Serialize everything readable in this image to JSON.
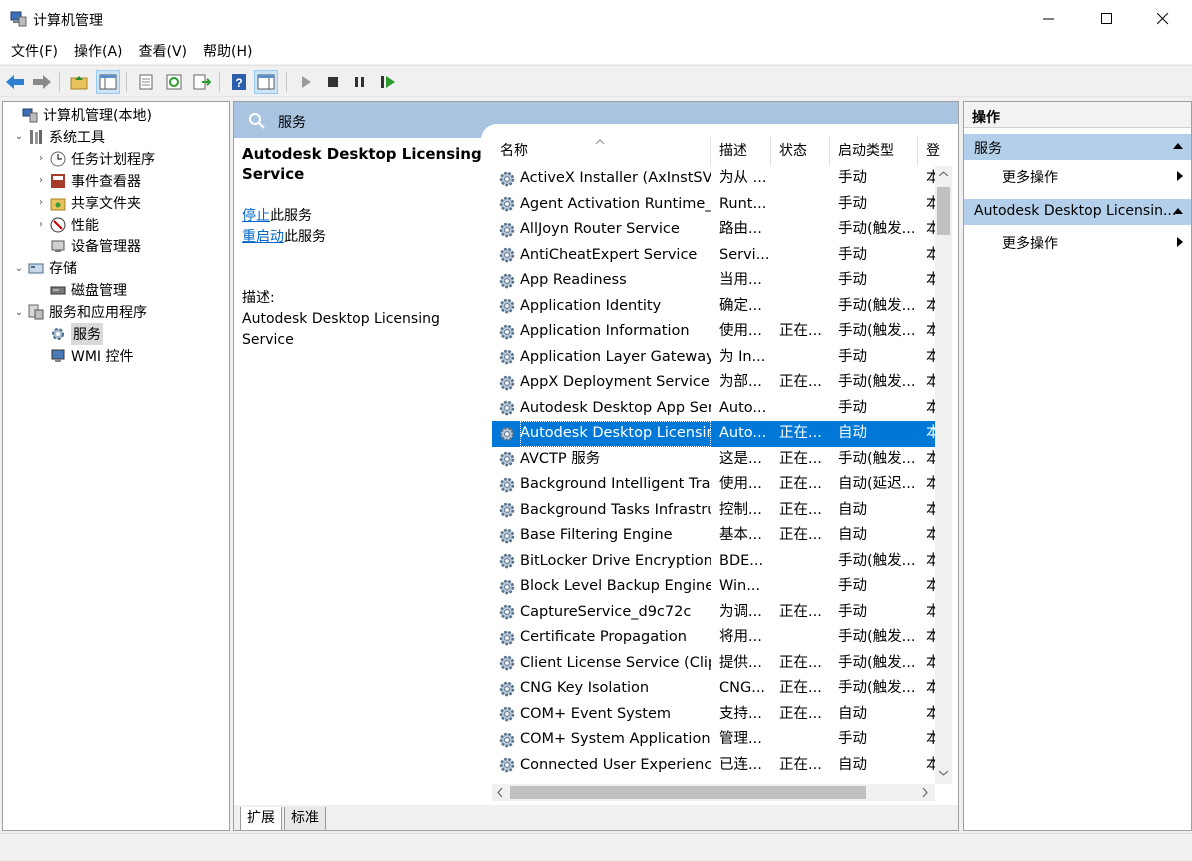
{
  "window": {
    "title": "计算机管理"
  },
  "menu": [
    "文件(F)",
    "操作(A)",
    "查看(V)",
    "帮助(H)"
  ],
  "tree": [
    {
      "label": "计算机管理(本地)",
      "indent": 0,
      "expander": "",
      "icon": "computer-management-icon"
    },
    {
      "label": "系统工具",
      "indent": 1,
      "expander": "v",
      "icon": "system-tools-icon"
    },
    {
      "label": "任务计划程序",
      "indent": 2,
      "expander": ">",
      "icon": "task-scheduler-icon"
    },
    {
      "label": "事件查看器",
      "indent": 2,
      "expander": ">",
      "icon": "event-viewer-icon"
    },
    {
      "label": "共享文件夹",
      "indent": 2,
      "expander": ">",
      "icon": "shared-folders-icon"
    },
    {
      "label": "性能",
      "indent": 2,
      "expander": ">",
      "icon": "performance-icon"
    },
    {
      "label": "设备管理器",
      "indent": 2,
      "expander": "",
      "icon": "device-manager-icon"
    },
    {
      "label": "存储",
      "indent": 1,
      "expander": "v",
      "icon": "storage-icon"
    },
    {
      "label": "磁盘管理",
      "indent": 2,
      "expander": "",
      "icon": "disk-management-icon"
    },
    {
      "label": "服务和应用程序",
      "indent": 1,
      "expander": "v",
      "icon": "services-apps-icon"
    },
    {
      "label": "服务",
      "indent": 2,
      "expander": "",
      "icon": "services-icon",
      "selected": true
    },
    {
      "label": "WMI 控件",
      "indent": 2,
      "expander": "",
      "icon": "wmi-control-icon"
    }
  ],
  "center": {
    "header_title": "服务",
    "detail": {
      "service_name": "Autodesk Desktop Licensing Service",
      "stop_link": "停止",
      "stop_suffix": "此服务",
      "restart_link": "重启动",
      "restart_suffix": "此服务",
      "desc_label": "描述:",
      "desc_text": "Autodesk Desktop Licensing Service"
    },
    "columns": [
      "名称",
      "描述",
      "状态",
      "启动类型",
      "登"
    ],
    "rows": [
      [
        "ActiveX Installer (AxInstSV)",
        "为从 ...",
        "",
        "手动",
        "本"
      ],
      [
        "Agent Activation Runtime_...",
        "Runt...",
        "",
        "手动",
        "本"
      ],
      [
        "AllJoyn Router Service",
        "路由...",
        "",
        "手动(触发...",
        "本"
      ],
      [
        "AntiCheatExpert Service",
        "Servi...",
        "",
        "手动",
        "本"
      ],
      [
        "App Readiness",
        "当用...",
        "",
        "手动",
        "本"
      ],
      [
        "Application Identity",
        "确定...",
        "",
        "手动(触发...",
        "本"
      ],
      [
        "Application Information",
        "使用...",
        "正在...",
        "手动(触发...",
        "本"
      ],
      [
        "Application Layer Gateway ...",
        "为 In...",
        "",
        "手动",
        "本"
      ],
      [
        "AppX Deployment Service ...",
        "为部...",
        "正在...",
        "手动(触发...",
        "本"
      ],
      [
        "Autodesk Desktop App Ser...",
        "Auto...",
        "",
        "手动",
        "本"
      ],
      [
        "Autodesk Desktop Licensin...",
        "Auto...",
        "正在...",
        "自动",
        "本"
      ],
      [
        "AVCTP 服务",
        "这是...",
        "正在...",
        "手动(触发...",
        "本"
      ],
      [
        "Background Intelligent Tra...",
        "使用...",
        "正在...",
        "自动(延迟...",
        "本"
      ],
      [
        "Background Tasks Infrastru...",
        "控制...",
        "正在...",
        "自动",
        "本"
      ],
      [
        "Base Filtering Engine",
        "基本...",
        "正在...",
        "自动",
        "本"
      ],
      [
        "BitLocker Drive Encryption ...",
        "BDE...",
        "",
        "手动(触发...",
        "本"
      ],
      [
        "Block Level Backup Engine ...",
        "Win...",
        "",
        "手动",
        "本"
      ],
      [
        "CaptureService_d9c72c",
        "为调...",
        "正在...",
        "手动",
        "本"
      ],
      [
        "Certificate Propagation",
        "将用...",
        "",
        "手动(触发...",
        "本"
      ],
      [
        "Client License Service (Clip...",
        "提供...",
        "正在...",
        "手动(触发...",
        "本"
      ],
      [
        "CNG Key Isolation",
        "CNG...",
        "正在...",
        "手动(触发...",
        "本"
      ],
      [
        "COM+ Event System",
        "支持...",
        "正在...",
        "自动",
        "本"
      ],
      [
        "COM+ System Application",
        "管理...",
        "",
        "手动",
        "本"
      ],
      [
        "Connected User Experienc...",
        "已连...",
        "正在...",
        "自动",
        "本"
      ],
      [
        "",
        "",
        "",
        "",
        ""
      ]
    ],
    "selected_row": 10,
    "tabs": [
      "扩展",
      "标准"
    ]
  },
  "actions": {
    "title": "操作",
    "sections": [
      {
        "title": "服务",
        "item": "更多操作"
      },
      {
        "title": "Autodesk Desktop Licensin...",
        "item": "更多操作"
      }
    ]
  }
}
